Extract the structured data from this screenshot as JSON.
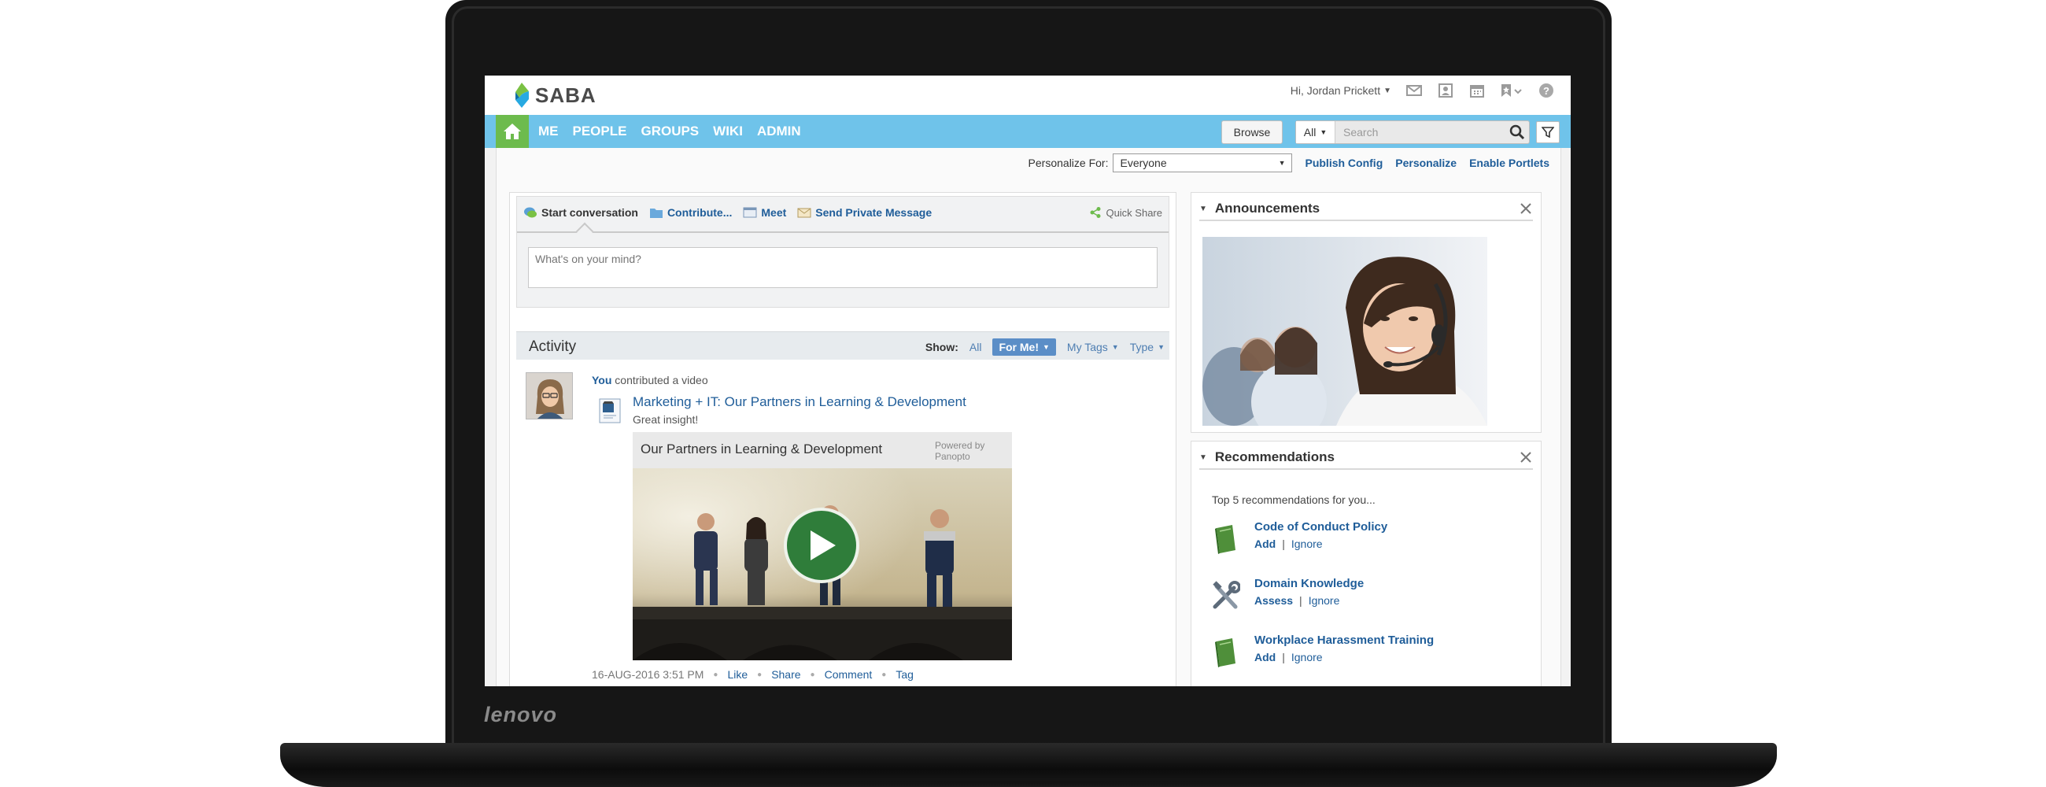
{
  "device": {
    "brand": "lenovo"
  },
  "app": {
    "logo_text": "SABA"
  },
  "user_bar": {
    "greeting": "Hi, Jordan Prickett",
    "icons": [
      "mail-icon",
      "contact-card-icon",
      "calendar-icon",
      "bookmark-icon",
      "help-icon"
    ]
  },
  "nav": {
    "items": [
      {
        "label": "ME"
      },
      {
        "label": "PEOPLE"
      },
      {
        "label": "GROUPS"
      },
      {
        "label": "WIKI"
      },
      {
        "label": "ADMIN"
      }
    ],
    "browse_label": "Browse",
    "search_scope": "All",
    "search_placeholder": "Search"
  },
  "personalize": {
    "label": "Personalize For:",
    "selected": "Everyone",
    "links": [
      "Publish Config",
      "Personalize",
      "Enable Portlets"
    ]
  },
  "share": {
    "tabs": [
      "Start conversation",
      "Contribute...",
      "Meet",
      "Send Private Message"
    ],
    "quick_share": "Quick Share",
    "input_placeholder": "What's on your mind?"
  },
  "activity": {
    "title": "Activity",
    "show_label": "Show:",
    "filters": {
      "all": "All",
      "for_me": "For Me!",
      "my_tags": "My Tags",
      "type": "Type"
    },
    "item": {
      "actor": "You",
      "action": " contributed a video",
      "title": "Marketing + IT: Our Partners in Learning & Development",
      "comment": "Great insight!",
      "video_title": "Our Partners in Learning & Development",
      "powered_by": "Powered by Panopto",
      "date": "16-AUG-2016 3:51 PM",
      "actions": [
        "Like",
        "Share",
        "Comment",
        "Tag"
      ]
    }
  },
  "announcements": {
    "title": "Announcements"
  },
  "recommendations": {
    "title": "Recommendations",
    "intro": "Top 5 recommendations for you...",
    "items": [
      {
        "title": "Code of Conduct Policy",
        "primary": "Add",
        "sep": "|",
        "secondary": "Ignore",
        "icon": "book-icon"
      },
      {
        "title": "Domain Knowledge",
        "primary": "Assess",
        "sep": "|",
        "secondary": "Ignore",
        "icon": "tools-icon"
      },
      {
        "title": "Workplace Harassment Training",
        "primary": "Add",
        "sep": "|",
        "secondary": "Ignore",
        "icon": "book-icon"
      }
    ]
  },
  "colors": {
    "nav_bg": "#6fc3ea",
    "home_bg": "#6dbb4d",
    "link": "#1f5d99",
    "active_filter": "#5b8ec7",
    "play_button": "#2f7d3a"
  }
}
